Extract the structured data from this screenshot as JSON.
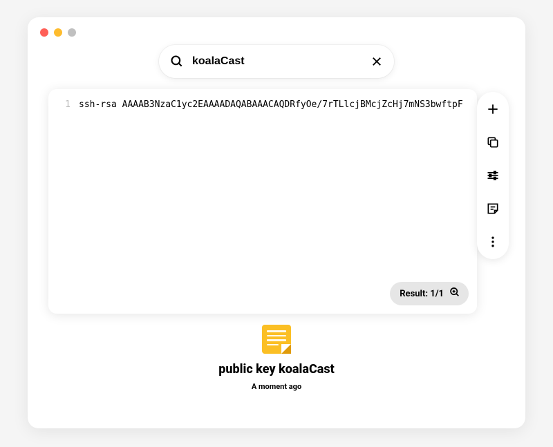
{
  "search": {
    "value": "koalaCast"
  },
  "code": {
    "line_number": "1",
    "content": "ssh-rsa AAAAB3NzaC1yc2EAAAADAQABAAACAQDRfyOe/7rTLlcjBMcjZcHj7mNS3bwftpF"
  },
  "result_badge": {
    "text": "Result: 1/1"
  },
  "footer": {
    "title": "public key koalaCast",
    "timestamp": "A moment ago"
  }
}
